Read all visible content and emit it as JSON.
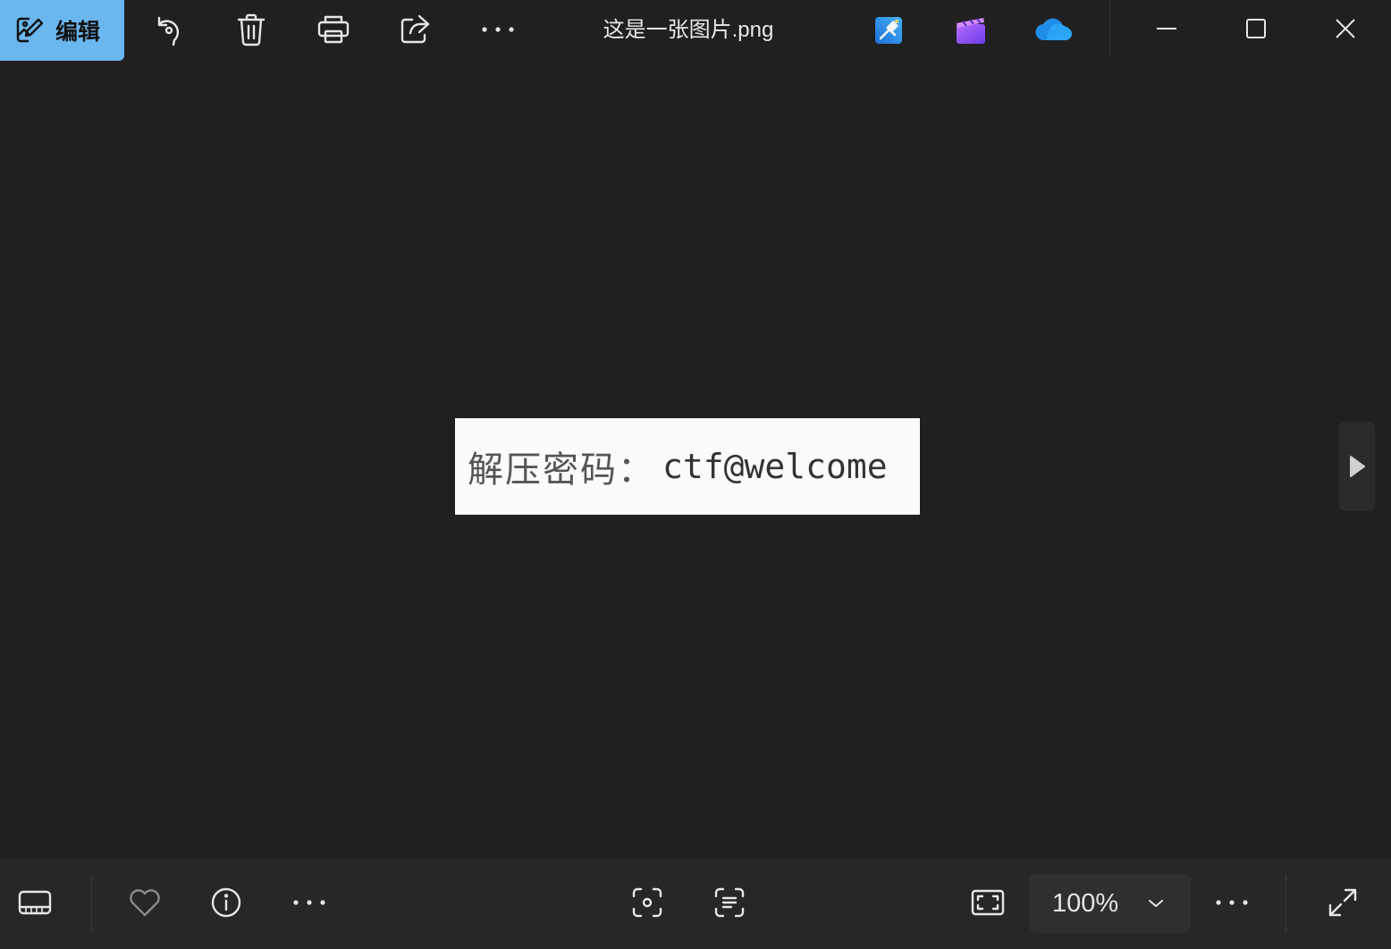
{
  "toolbar": {
    "edit_label": "编辑",
    "icons": {
      "edit": "edit-image-icon",
      "rotate": "rotate-icon",
      "delete": "delete-icon",
      "print": "print-icon",
      "share": "share-icon",
      "more": "more-icon"
    }
  },
  "window": {
    "title": "这是一张图片.png",
    "app_icons": [
      "clipchamp-edit-icon",
      "video-editor-icon",
      "onedrive-icon"
    ],
    "controls": [
      "minimize-icon",
      "maximize-icon",
      "close-icon"
    ]
  },
  "image": {
    "label": "解压密码：",
    "code": "ctf@welcome"
  },
  "bottombar": {
    "zoom_value": "100%",
    "icons": [
      "filmstrip-icon",
      "favorite-icon",
      "info-icon",
      "more-icon",
      "visual-search-icon",
      "text-scan-icon",
      "fit-to-window-icon",
      "chevron-down-icon",
      "more-icon",
      "fullscreen-icon"
    ]
  },
  "colors": {
    "accent": "#6ab7f0",
    "background": "#202020",
    "bottombar": "#272727"
  }
}
